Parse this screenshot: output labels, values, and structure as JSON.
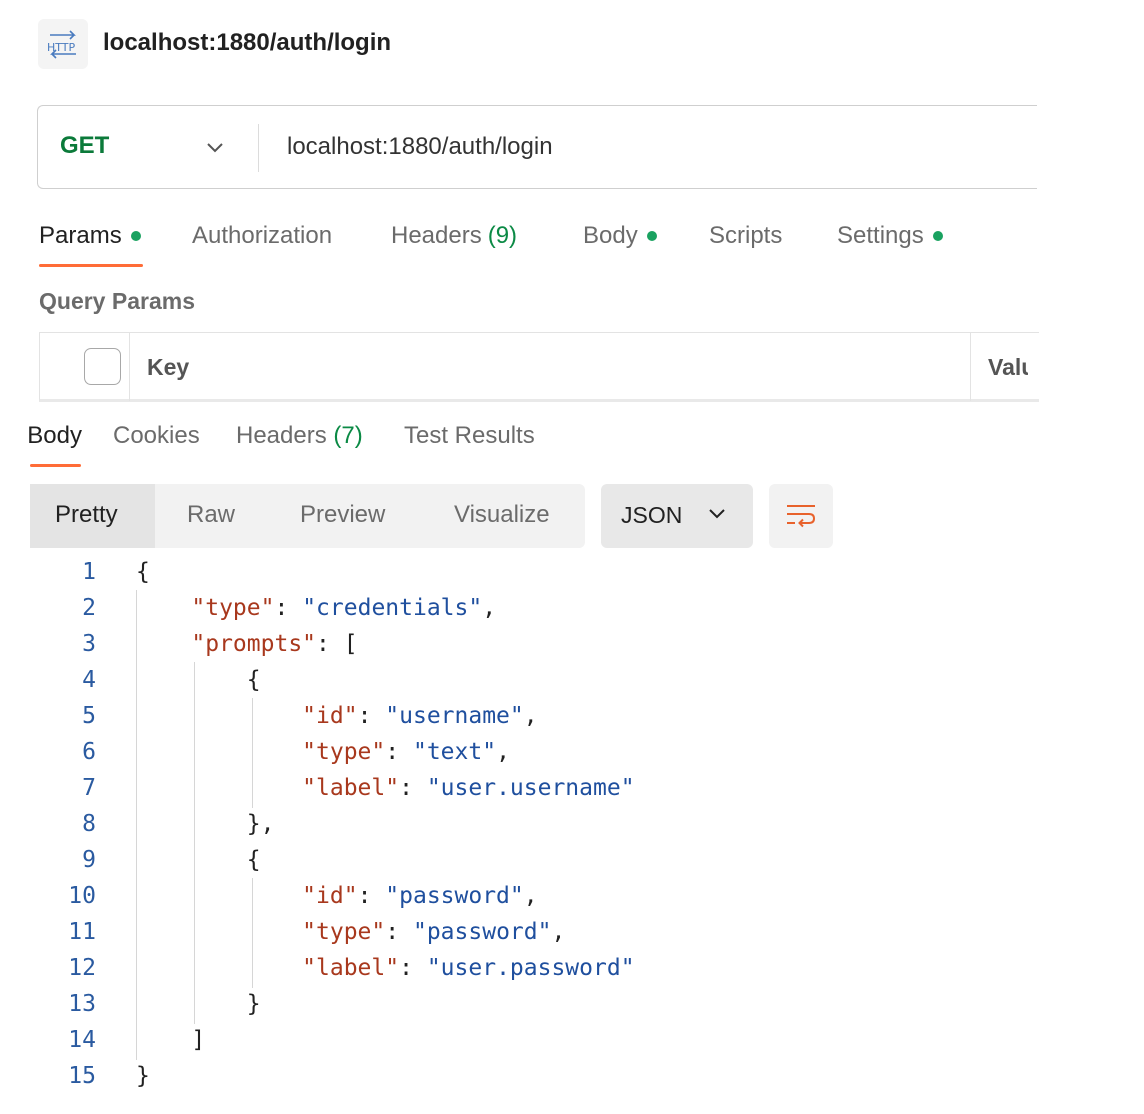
{
  "header": {
    "icon": "http-request-icon",
    "icon_text": "HTTP",
    "title": "localhost:1880/auth/login"
  },
  "request": {
    "method": "GET",
    "url": "localhost:1880/auth/login"
  },
  "request_tabs": [
    {
      "label": "Params",
      "count": "",
      "dot": true,
      "active": true
    },
    {
      "label": "Authorization",
      "count": "",
      "dot": false,
      "active": false
    },
    {
      "label": "Headers",
      "count": "(9)",
      "dot": false,
      "active": false
    },
    {
      "label": "Body",
      "count": "",
      "dot": true,
      "active": false
    },
    {
      "label": "Scripts",
      "count": "",
      "dot": false,
      "active": false
    },
    {
      "label": "Settings",
      "count": "",
      "dot": true,
      "active": false
    }
  ],
  "query_params": {
    "title": "Query Params",
    "columns": [
      "Key",
      "Value"
    ]
  },
  "response_tabs": [
    {
      "label": "Body",
      "count": "",
      "active": true
    },
    {
      "label": "Cookies",
      "count": "",
      "active": false
    },
    {
      "label": "Headers",
      "count": "(7)",
      "active": false
    },
    {
      "label": "Test Results",
      "count": "",
      "active": false
    }
  ],
  "view_modes": [
    "Pretty",
    "Raw",
    "Preview",
    "Visualize"
  ],
  "active_view_mode": "Pretty",
  "format": "JSON",
  "colors": {
    "accent": "#ff6c37",
    "method_get": "#0b7a3a",
    "dot": "#1aa260",
    "json_key": "#a8381d",
    "json_string": "#1f4f9e"
  },
  "code_lines": [
    {
      "num": "1",
      "text": "{"
    },
    {
      "num": "2",
      "text": "    \"type\": \"credentials\","
    },
    {
      "num": "3",
      "text": "    \"prompts\": ["
    },
    {
      "num": "4",
      "text": "        {"
    },
    {
      "num": "5",
      "text": "            \"id\": \"username\","
    },
    {
      "num": "6",
      "text": "            \"type\": \"text\","
    },
    {
      "num": "7",
      "text": "            \"label\": \"user.username\""
    },
    {
      "num": "8",
      "text": "        },"
    },
    {
      "num": "9",
      "text": "        {"
    },
    {
      "num": "10",
      "text": "            \"id\": \"password\","
    },
    {
      "num": "11",
      "text": "            \"type\": \"password\","
    },
    {
      "num": "12",
      "text": "            \"label\": \"user.password\""
    },
    {
      "num": "13",
      "text": "        }"
    },
    {
      "num": "14",
      "text": "    ]"
    },
    {
      "num": "15",
      "text": "}"
    }
  ]
}
